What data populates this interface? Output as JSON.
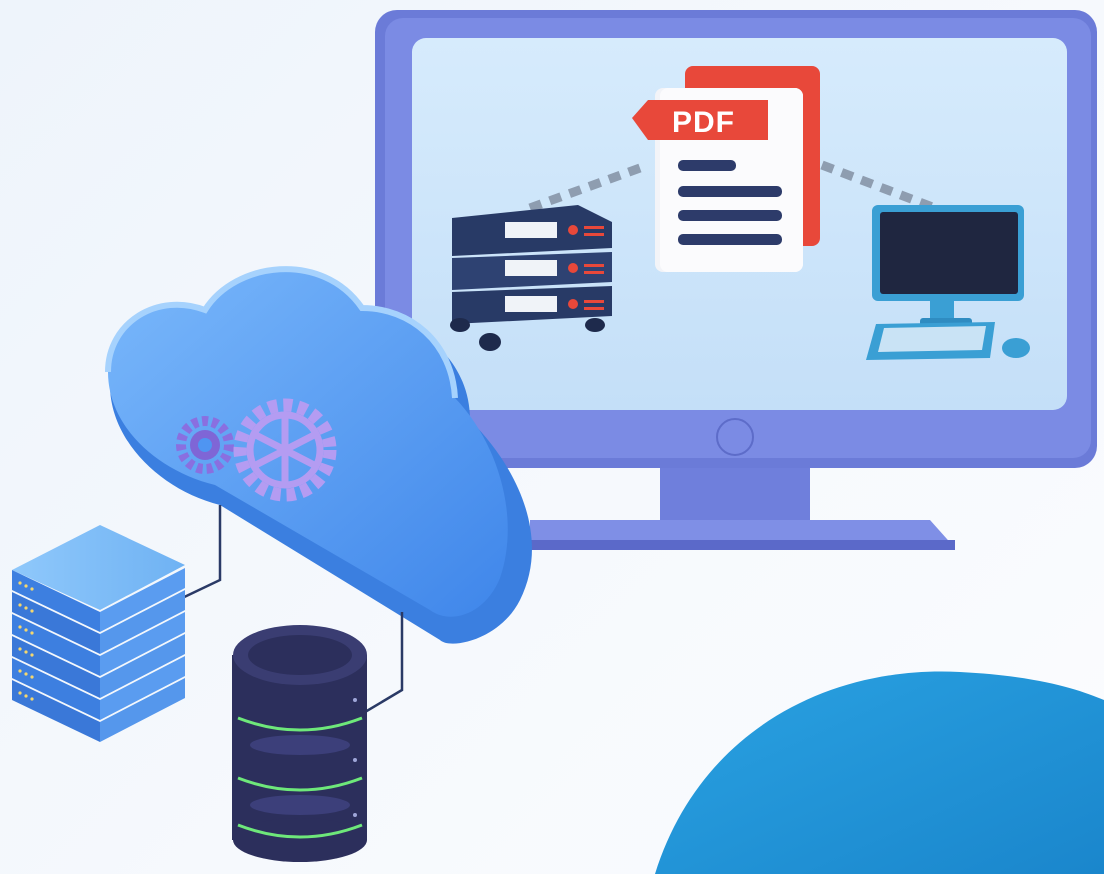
{
  "pdf_badge": {
    "label": "PDF"
  },
  "colors": {
    "background": "#f2f7fc",
    "monitor_frame": "#6f7fdc",
    "monitor_screen": "#cfe6fb",
    "cloud": "#4f95f2",
    "gear": "#b49cf2",
    "pdf_red": "#e8483a",
    "corner_blob": "#1e93d6",
    "database": "#2c2f5c",
    "db_stripe": "#6ee87a"
  },
  "icons": [
    "monitor-icon",
    "pdf-document-icon",
    "server-rack-icon",
    "desktop-computer-icon",
    "cloud-icon",
    "gear-icon",
    "server-stack-icon",
    "database-icon"
  ]
}
